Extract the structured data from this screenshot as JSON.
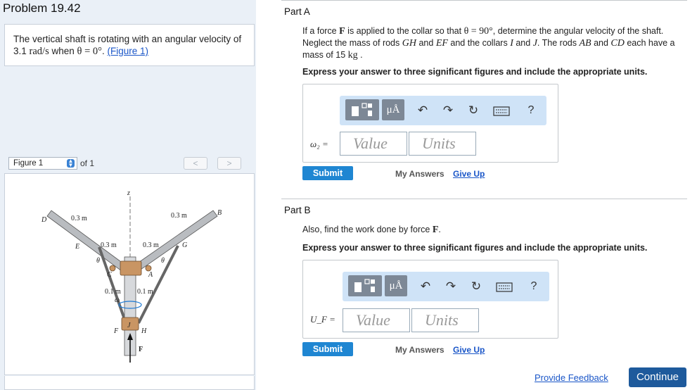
{
  "problem": {
    "title": "Problem 19.42",
    "text_a": "The vertical shaft is rotating with an angular velocity of",
    "text_b_value": "3.1",
    "text_b_unit": "rad/s",
    "text_b_when": "when",
    "text_b_theta": "θ = 0°",
    "text_b_dot": ".",
    "figure_link": "(Figure 1)"
  },
  "figure_nav": {
    "selected": "Figure 1",
    "of_label": "of 1",
    "prev": "<",
    "next": ">"
  },
  "figure_labels": {
    "z": "z",
    "D": "D",
    "B": "B",
    "E": "E",
    "G": "G",
    "C": "C",
    "A": "A",
    "F_rod": "F",
    "H": "H",
    "J": "J",
    "dim_03_left": "0.3 m",
    "dim_03_right": "0.3 m",
    "dim_03_inner_left": "0.3 m",
    "dim_03_inner_right": "0.3 m",
    "dim_01_left": "0.1 m",
    "dim_01_right": "0.1 m",
    "theta_left": "θ",
    "theta_right": "θ",
    "omega": "ω",
    "force": "F"
  },
  "part_a": {
    "title": "Part A",
    "q1": "If a force",
    "q_F": "F",
    "q2": "is applied to the collar so that",
    "q_theta": "θ = 90°",
    "q3": ", determine the angular velocity of the shaft. Neglect the mass of rods",
    "q_GH": "GH",
    "q_and1": "and",
    "q_EF": "EF",
    "q4": "and the collars",
    "q_I": "I",
    "q_and2": "and",
    "q_J": "J",
    "q5": ". The rods",
    "q_AB": "AB",
    "q_and3": "and",
    "q_CD": "CD",
    "q6": "each have a mass of",
    "q_mass": "15",
    "q_kg": "kg",
    "q7": ".",
    "instructions": "Express your answer to three significant figures and include the appropriate units.",
    "var_label": "ω₂ =",
    "value_placeholder": "Value",
    "units_placeholder": "Units",
    "submit": "Submit",
    "my_answers": "My Answers",
    "give_up": "Give Up"
  },
  "part_b": {
    "title": "Part B",
    "q1": "Also, find the work done by force",
    "q_F": "F",
    "q2": ".",
    "instructions": "Express your answer to three significant figures and include the appropriate units.",
    "var_label": "U_F =",
    "value_placeholder": "Value",
    "units_placeholder": "Units",
    "submit": "Submit",
    "my_answers": "My Answers",
    "give_up": "Give Up"
  },
  "toolbar": {
    "mu_label": "μÅ",
    "help": "?"
  },
  "footer": {
    "feedback": "Provide Feedback",
    "continue": "Continue"
  },
  "colors": {
    "left_bg": "#eaf0f7",
    "toolbar_bg": "#cfe3f7",
    "submit_bg": "#1f86d2",
    "continue_bg": "#1e5a9c",
    "link": "#1a56c8"
  }
}
